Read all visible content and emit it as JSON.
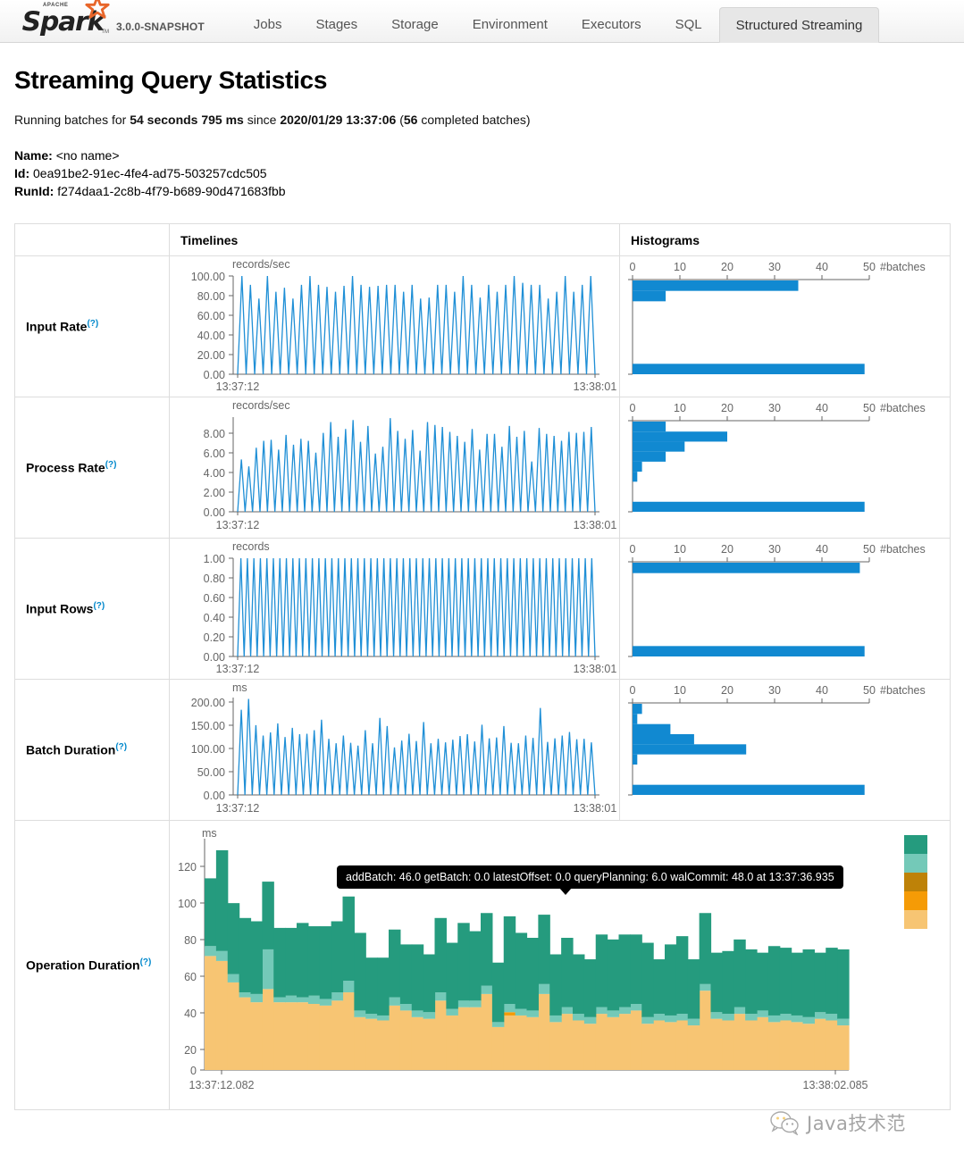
{
  "navbar": {
    "brand": "Spark",
    "brand_apache": "APACHE",
    "brand_tm": "TM",
    "version": "3.0.0-SNAPSHOT",
    "tabs": [
      {
        "label": "Jobs",
        "active": false
      },
      {
        "label": "Stages",
        "active": false
      },
      {
        "label": "Storage",
        "active": false
      },
      {
        "label": "Environment",
        "active": false
      },
      {
        "label": "Executors",
        "active": false
      },
      {
        "label": "SQL",
        "active": false
      },
      {
        "label": "Structured Streaming",
        "active": true
      }
    ]
  },
  "header": {
    "title": "Streaming Query Statistics",
    "running_prefix": "Running batches for ",
    "running_duration": "54 seconds 795 ms",
    "running_since": " since ",
    "running_start_time": "2020/01/29 13:37:06",
    "running_batches_open": " (",
    "running_batches_count": "56",
    "running_batches_close": " completed batches)",
    "name_key": "Name:",
    "name_value": "<no name>",
    "id_key": "Id:",
    "id_value": "0ea91be2-91ec-4fe4-ad75-503257cdc505",
    "runid_key": "RunId:",
    "runid_value": "f274daa1-2c8b-4f79-b689-90d471683fbb"
  },
  "table": {
    "headers": {
      "metric": "",
      "timelines": "Timelines",
      "histograms": "Histograms"
    },
    "help_marker": "(?)",
    "rows": [
      {
        "label": "Input Rate"
      },
      {
        "label": "Process Rate"
      },
      {
        "label": "Input Rows"
      },
      {
        "label": "Batch Duration"
      },
      {
        "label": "Operation Duration"
      }
    ]
  },
  "colors": {
    "line": "#1f8fd6",
    "bar": "#1189d1",
    "addBatch": "#259b7e",
    "getBatch": "#74c9b8",
    "latestOffset": "#be8208",
    "queryPlanning": "#f59b06",
    "walCommit": "#f7c573",
    "tooltip_bg": "#000000",
    "link": "#0088cc"
  },
  "watermark": {
    "text": "Java技术范",
    "icon": "wechat-icon"
  },
  "chart_data": [
    {
      "type": "line",
      "name": "input-rate-timeline",
      "ylabel": "records/sec",
      "yticks": [
        "0.00",
        "20.00",
        "40.00",
        "60.00",
        "80.00",
        "100.00"
      ],
      "ylim": [
        0,
        100
      ],
      "xticks": [
        "13:37:12",
        "13:38:01"
      ],
      "grid": false,
      "values": [
        0,
        100,
        0,
        91,
        0,
        77,
        0,
        100,
        0,
        84,
        0,
        88,
        0,
        77,
        0,
        91,
        0,
        100,
        0,
        91,
        0,
        89,
        0,
        84,
        0,
        90,
        0,
        100,
        0,
        91,
        0,
        89,
        0,
        90,
        0,
        91,
        0,
        91,
        0,
        84,
        0,
        91,
        0,
        77,
        0,
        78,
        0,
        91,
        0,
        91,
        0,
        84,
        0,
        100,
        0,
        91,
        0,
        78,
        0,
        91,
        0,
        84,
        0,
        91,
        0,
        100,
        0,
        93,
        0,
        91,
        0,
        91,
        0,
        77,
        0,
        84,
        0,
        100,
        0,
        84,
        0,
        91,
        0,
        100,
        0
      ]
    },
    {
      "type": "bar",
      "name": "input-rate-histogram",
      "xlabel": "#batches",
      "xticks": [
        0,
        10,
        20,
        30,
        40,
        50
      ],
      "xlim": [
        0,
        50
      ],
      "values": [
        35,
        7,
        0,
        0,
        0,
        0,
        0,
        0,
        49
      ],
      "orientation": "horizontal"
    },
    {
      "type": "line",
      "name": "process-rate-timeline",
      "ylabel": "records/sec",
      "yticks": [
        "0.00",
        "2.00",
        "4.00",
        "6.00",
        "8.00"
      ],
      "ylim": [
        0,
        9.6
      ],
      "xticks": [
        "13:37:12",
        "13:38:01"
      ],
      "grid": false,
      "values": [
        0,
        5.3,
        0,
        4.6,
        0,
        6.5,
        0,
        7.2,
        0,
        7.3,
        0,
        6.3,
        0,
        7.8,
        0,
        6.8,
        0,
        7.4,
        0,
        7.2,
        0,
        6.0,
        0,
        8.0,
        0,
        9.1,
        0,
        7.6,
        0,
        8.4,
        0,
        9.3,
        0,
        7.1,
        0,
        8.7,
        0,
        5.9,
        0,
        6.6,
        0,
        9.5,
        0,
        8.2,
        0,
        7.4,
        0,
        8.3,
        0,
        6.2,
        0,
        9.1,
        0,
        8.8,
        0,
        8.6,
        0,
        8.1,
        0,
        7.7,
        0,
        7.1,
        0,
        8.4,
        0,
        6.3,
        0,
        7.9,
        0,
        7.9,
        0,
        6.6,
        0,
        8.7,
        0,
        7.6,
        0,
        8.2,
        0,
        5.1,
        0,
        8.5,
        0,
        7.9,
        0,
        7.7,
        0,
        7.2,
        0,
        8.1,
        0,
        8.0,
        0,
        8.1,
        0,
        8.6,
        0
      ]
    },
    {
      "type": "bar",
      "name": "process-rate-histogram",
      "xlabel": "#batches",
      "xticks": [
        0,
        10,
        20,
        30,
        40,
        50
      ],
      "xlim": [
        0,
        50
      ],
      "values": [
        7,
        20,
        11,
        7,
        2,
        1,
        0,
        0,
        49
      ],
      "orientation": "horizontal"
    },
    {
      "type": "line",
      "name": "input-rows-timeline",
      "ylabel": "records",
      "yticks": [
        "0.00",
        "0.20",
        "0.40",
        "0.60",
        "0.80",
        "1.00"
      ],
      "ylim": [
        0,
        1
      ],
      "xticks": [
        "13:37:12",
        "13:38:01"
      ],
      "grid": false,
      "values": [
        0,
        1,
        0,
        1,
        0,
        1,
        0,
        1,
        0,
        1,
        0,
        1,
        0,
        1,
        0,
        1,
        0,
        1,
        0,
        1,
        0,
        1,
        0,
        1,
        0,
        1,
        0,
        1,
        0,
        1,
        0,
        1,
        0,
        1,
        0,
        1,
        0,
        1,
        0,
        1,
        0,
        1,
        0,
        1,
        0,
        1,
        0,
        1,
        0,
        1,
        0,
        1,
        0,
        1,
        0,
        1,
        0,
        1,
        0,
        1,
        0,
        1,
        0,
        1,
        0,
        1,
        0,
        1,
        0,
        1,
        0,
        1,
        0,
        1,
        0,
        1,
        0,
        1,
        0,
        1,
        0,
        1,
        0,
        1,
        0,
        1,
        0,
        1,
        0,
        1,
        0,
        1,
        0,
        1,
        0,
        1,
        0,
        1,
        0,
        1,
        0,
        1,
        0,
        1,
        0,
        1,
        0,
        1,
        0,
        1,
        0
      ]
    },
    {
      "type": "bar",
      "name": "input-rows-histogram",
      "xlabel": "#batches",
      "xticks": [
        0,
        10,
        20,
        30,
        40,
        50
      ],
      "xlim": [
        0,
        50
      ],
      "values": [
        48,
        0,
        0,
        0,
        0,
        0,
        0,
        0,
        49
      ],
      "orientation": "horizontal"
    },
    {
      "type": "line",
      "name": "batch-duration-timeline",
      "ylabel": "ms",
      "yticks": [
        "0.00",
        "50.00",
        "100.00",
        "150.00",
        "200.00"
      ],
      "ylim": [
        0,
        215
      ],
      "xticks": [
        "13:37:12",
        "13:38:01"
      ],
      "grid": false,
      "values": [
        0,
        188,
        0,
        212,
        0,
        154,
        0,
        131,
        0,
        138,
        0,
        158,
        0,
        128,
        0,
        148,
        0,
        134,
        0,
        135,
        0,
        143,
        0,
        166,
        0,
        124,
        0,
        114,
        0,
        131,
        0,
        115,
        0,
        109,
        0,
        143,
        0,
        114,
        0,
        170,
        0,
        152,
        0,
        105,
        0,
        120,
        0,
        135,
        0,
        119,
        0,
        161,
        0,
        114,
        0,
        124,
        0,
        116,
        0,
        122,
        0,
        130,
        0,
        134,
        0,
        118,
        0,
        155,
        0,
        125,
        0,
        127,
        0,
        152,
        0,
        115,
        0,
        114,
        0,
        131,
        0,
        126,
        0,
        192,
        0,
        117,
        0,
        125,
        0,
        131,
        0,
        139,
        0,
        123,
        0,
        124,
        0,
        116,
        0
      ]
    },
    {
      "type": "bar",
      "name": "batch-duration-histogram",
      "xlabel": "#batches",
      "xticks": [
        0,
        10,
        20,
        30,
        40,
        50
      ],
      "xlim": [
        0,
        50
      ],
      "values": [
        2,
        1,
        8,
        13,
        24,
        1,
        0,
        0,
        49
      ],
      "orientation": "horizontal"
    },
    {
      "type": "area",
      "name": "operation-duration-stacked",
      "ylabel": "ms",
      "yticks": [
        0,
        20,
        40,
        60,
        80,
        100,
        120
      ],
      "ylim": [
        0,
        140
      ],
      "xticks": [
        "13:37:12.082",
        "13:38:02.085"
      ],
      "grid": false,
      "legend": [
        "addBatch",
        "getBatch",
        "latestOffset",
        "queryPlanning",
        "walCommit"
      ],
      "legend_position": "right",
      "tooltip": "addBatch: 46.0 getBatch: 0.0 latestOffset: 0.0 queryPlanning: 6.0 walCommit: 48.0 at 13:37:36.935",
      "series": [
        {
          "name": "walCommit",
          "color": "#f7c573",
          "values": [
            69,
            66,
            53,
            44,
            41,
            49,
            41,
            41,
            41,
            40,
            39,
            42,
            47,
            32,
            31,
            30,
            39,
            36,
            32,
            31,
            42,
            33,
            38,
            38,
            46,
            26,
            33,
            33,
            32,
            46,
            29,
            34,
            30,
            28,
            34,
            32,
            34,
            36,
            28,
            30,
            29,
            30,
            27,
            48,
            31,
            30,
            34,
            30,
            32,
            29,
            30,
            29,
            28,
            31,
            30,
            27
          ]
        },
        {
          "name": "queryPlanning",
          "color": "#f59b06",
          "values": [
            0,
            0,
            0,
            0,
            0,
            0,
            0,
            0,
            0,
            0,
            0,
            0,
            0,
            0,
            0,
            0,
            0,
            0,
            0,
            0,
            0,
            0,
            0,
            0,
            0,
            0,
            2,
            0,
            0,
            0,
            0,
            0,
            0,
            0,
            0,
            0,
            0,
            0,
            0,
            0,
            0,
            0,
            0,
            0,
            0,
            0,
            0,
            0,
            0,
            0,
            0,
            0,
            0,
            0,
            0,
            0
          ]
        },
        {
          "name": "latestOffset",
          "color": "#be8208",
          "values": [
            0,
            0,
            0,
            0,
            0,
            0,
            0,
            0,
            0,
            0,
            0,
            0,
            0,
            0,
            0,
            0,
            0,
            0,
            0,
            0,
            0,
            0,
            0,
            0,
            0,
            0,
            0,
            0,
            0,
            0,
            0,
            0,
            0,
            0,
            0,
            0,
            0,
            0,
            0,
            0,
            0,
            0,
            0,
            0,
            0,
            0,
            0,
            0,
            0,
            0,
            0,
            0,
            0,
            0,
            0,
            0
          ]
        },
        {
          "name": "getBatch",
          "color": "#74c9b8",
          "values": [
            6,
            6,
            5,
            3,
            5,
            24,
            3,
            4,
            3,
            5,
            4,
            5,
            7,
            4,
            3,
            3,
            5,
            4,
            4,
            4,
            5,
            4,
            4,
            4,
            5,
            3,
            5,
            4,
            4,
            6,
            4,
            4,
            4,
            4,
            4,
            4,
            4,
            4,
            4,
            4,
            4,
            4,
            4,
            4,
            4,
            4,
            4,
            4,
            4,
            4,
            4,
            4,
            4,
            4,
            4,
            4
          ]
        },
        {
          "name": "addBatch",
          "color": "#259b7e",
          "values": [
            41,
            61,
            43,
            45,
            44,
            41,
            42,
            41,
            45,
            42,
            44,
            43,
            51,
            47,
            34,
            35,
            41,
            36,
            40,
            35,
            45,
            40,
            47,
            42,
            44,
            36,
            53,
            46,
            44,
            42,
            37,
            42,
            36,
            35,
            44,
            43,
            44,
            42,
            45,
            33,
            43,
            47,
            36,
            43,
            36,
            38,
            41,
            39,
            35,
            42,
            40,
            38,
            41,
            36,
            40,
            42
          ]
        }
      ]
    }
  ]
}
